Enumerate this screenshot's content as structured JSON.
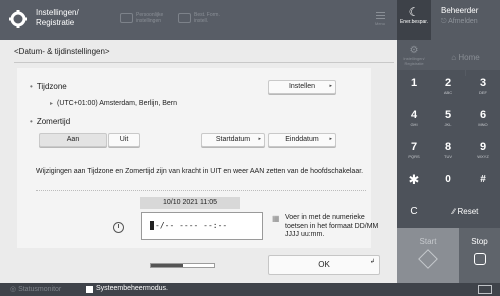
{
  "topbar": {
    "title_line1": "Instellingen/",
    "title_line2": "Registratie",
    "dim1_line1": "Persoonlijke",
    "dim1_line2": "instellingen",
    "dim2_line1": "Best. Form.",
    "dim2_line2": "instell.",
    "menu_label": "Menu"
  },
  "right_panel": {
    "energy_label": "Ener.bespar.",
    "user": "Beheerder",
    "logout": "Afmelden",
    "settings_line1": "Instellingen/",
    "settings_line2": "Registratie",
    "home": "Home",
    "keys": [
      {
        "digit": "1",
        "letters": ""
      },
      {
        "digit": "2",
        "letters": "ABC"
      },
      {
        "digit": "3",
        "letters": "DEF"
      },
      {
        "digit": "4",
        "letters": "GHI"
      },
      {
        "digit": "5",
        "letters": "JKL"
      },
      {
        "digit": "6",
        "letters": "MNO"
      },
      {
        "digit": "7",
        "letters": "PQRS"
      },
      {
        "digit": "8",
        "letters": "TUV"
      },
      {
        "digit": "9",
        "letters": "WXYZ"
      }
    ],
    "star": "✱",
    "zero": "0",
    "hash": "#",
    "clear": "C",
    "reset": "Reset",
    "start": "Start",
    "stop": "Stop"
  },
  "main": {
    "breadcrumb": "<Datum- & tijdinstellingen>",
    "timezone_label": "Tijdzone",
    "timezone_value": "(UTC+01:00) Amsterdam, Berlijn, Bern",
    "set_button": "Instellen",
    "dst_label": "Zomertijd",
    "on": "Aan",
    "off": "Uit",
    "start_date": "Startdatum",
    "end_date": "Einddatum",
    "info_text": "Wijzigingen aan Tijdzone en Zomertijd zijn van kracht in UIT en weer AAN zetten van de hoofdschakelaar.",
    "current_datetime": "10/10 2021 11:05",
    "entry_value": "-/-- ---- --:--",
    "hint": "Voer in met de numerieke toetsen in het formaat DD/MM JJJJ uu:mm.",
    "ok": "OK",
    "progress_fraction": 0.5
  },
  "statusbar": {
    "monitor": "Statusmonitor",
    "message": "Systeembeheermodus."
  }
}
